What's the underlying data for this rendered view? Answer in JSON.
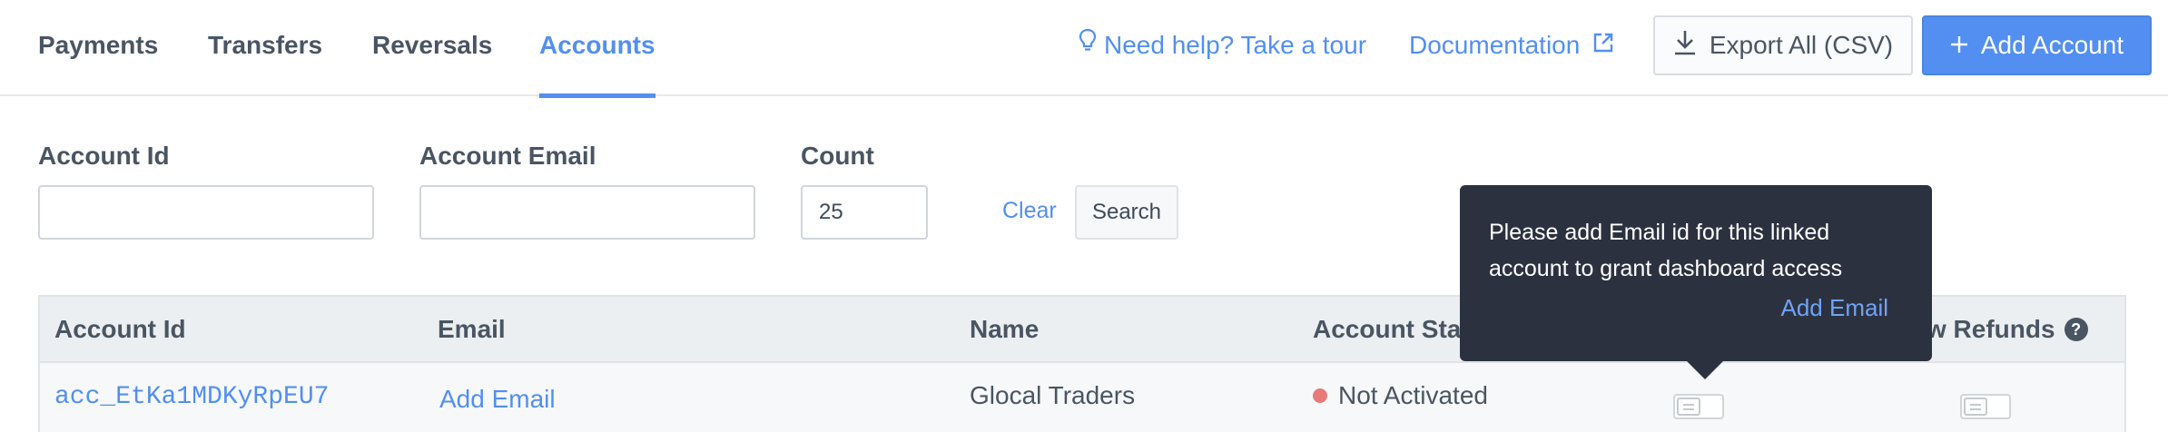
{
  "tabs": [
    {
      "label": "Payments"
    },
    {
      "label": "Transfers"
    },
    {
      "label": "Reversals"
    },
    {
      "label": "Accounts"
    }
  ],
  "header": {
    "help_label": "Need help? Take a tour",
    "docs_label": "Documentation",
    "export_label": "Export All (CSV)",
    "add_account_label": "Add Account"
  },
  "filters": {
    "account_id_label": "Account Id",
    "account_id_value": "",
    "account_email_label": "Account Email",
    "account_email_value": "",
    "count_label": "Count",
    "count_value": "25",
    "clear_label": "Clear",
    "search_label": "Search"
  },
  "table": {
    "columns": [
      "Account Id",
      "Email",
      "Name",
      "Account Stat",
      "w Refunds"
    ],
    "rows": [
      {
        "account_id": "acc_EtKa1MDKyRpEU7",
        "email": "Add Email",
        "name": "Glocal Traders",
        "status": "Not Activated"
      }
    ]
  },
  "tooltip": {
    "text": "Please add Email id for this linked account to grant dashboard access",
    "action_label": "Add Email"
  },
  "colors": {
    "accent": "#528ff0",
    "tooltip_bg": "#2c3140",
    "status_not_activated": "#e87a7a",
    "header_bg": "#eceff1"
  },
  "icons": {
    "help": "lightbulb-icon",
    "docs": "external-link-icon",
    "export": "download-icon",
    "add": "plus-icon",
    "refunds_help": "question-icon"
  }
}
